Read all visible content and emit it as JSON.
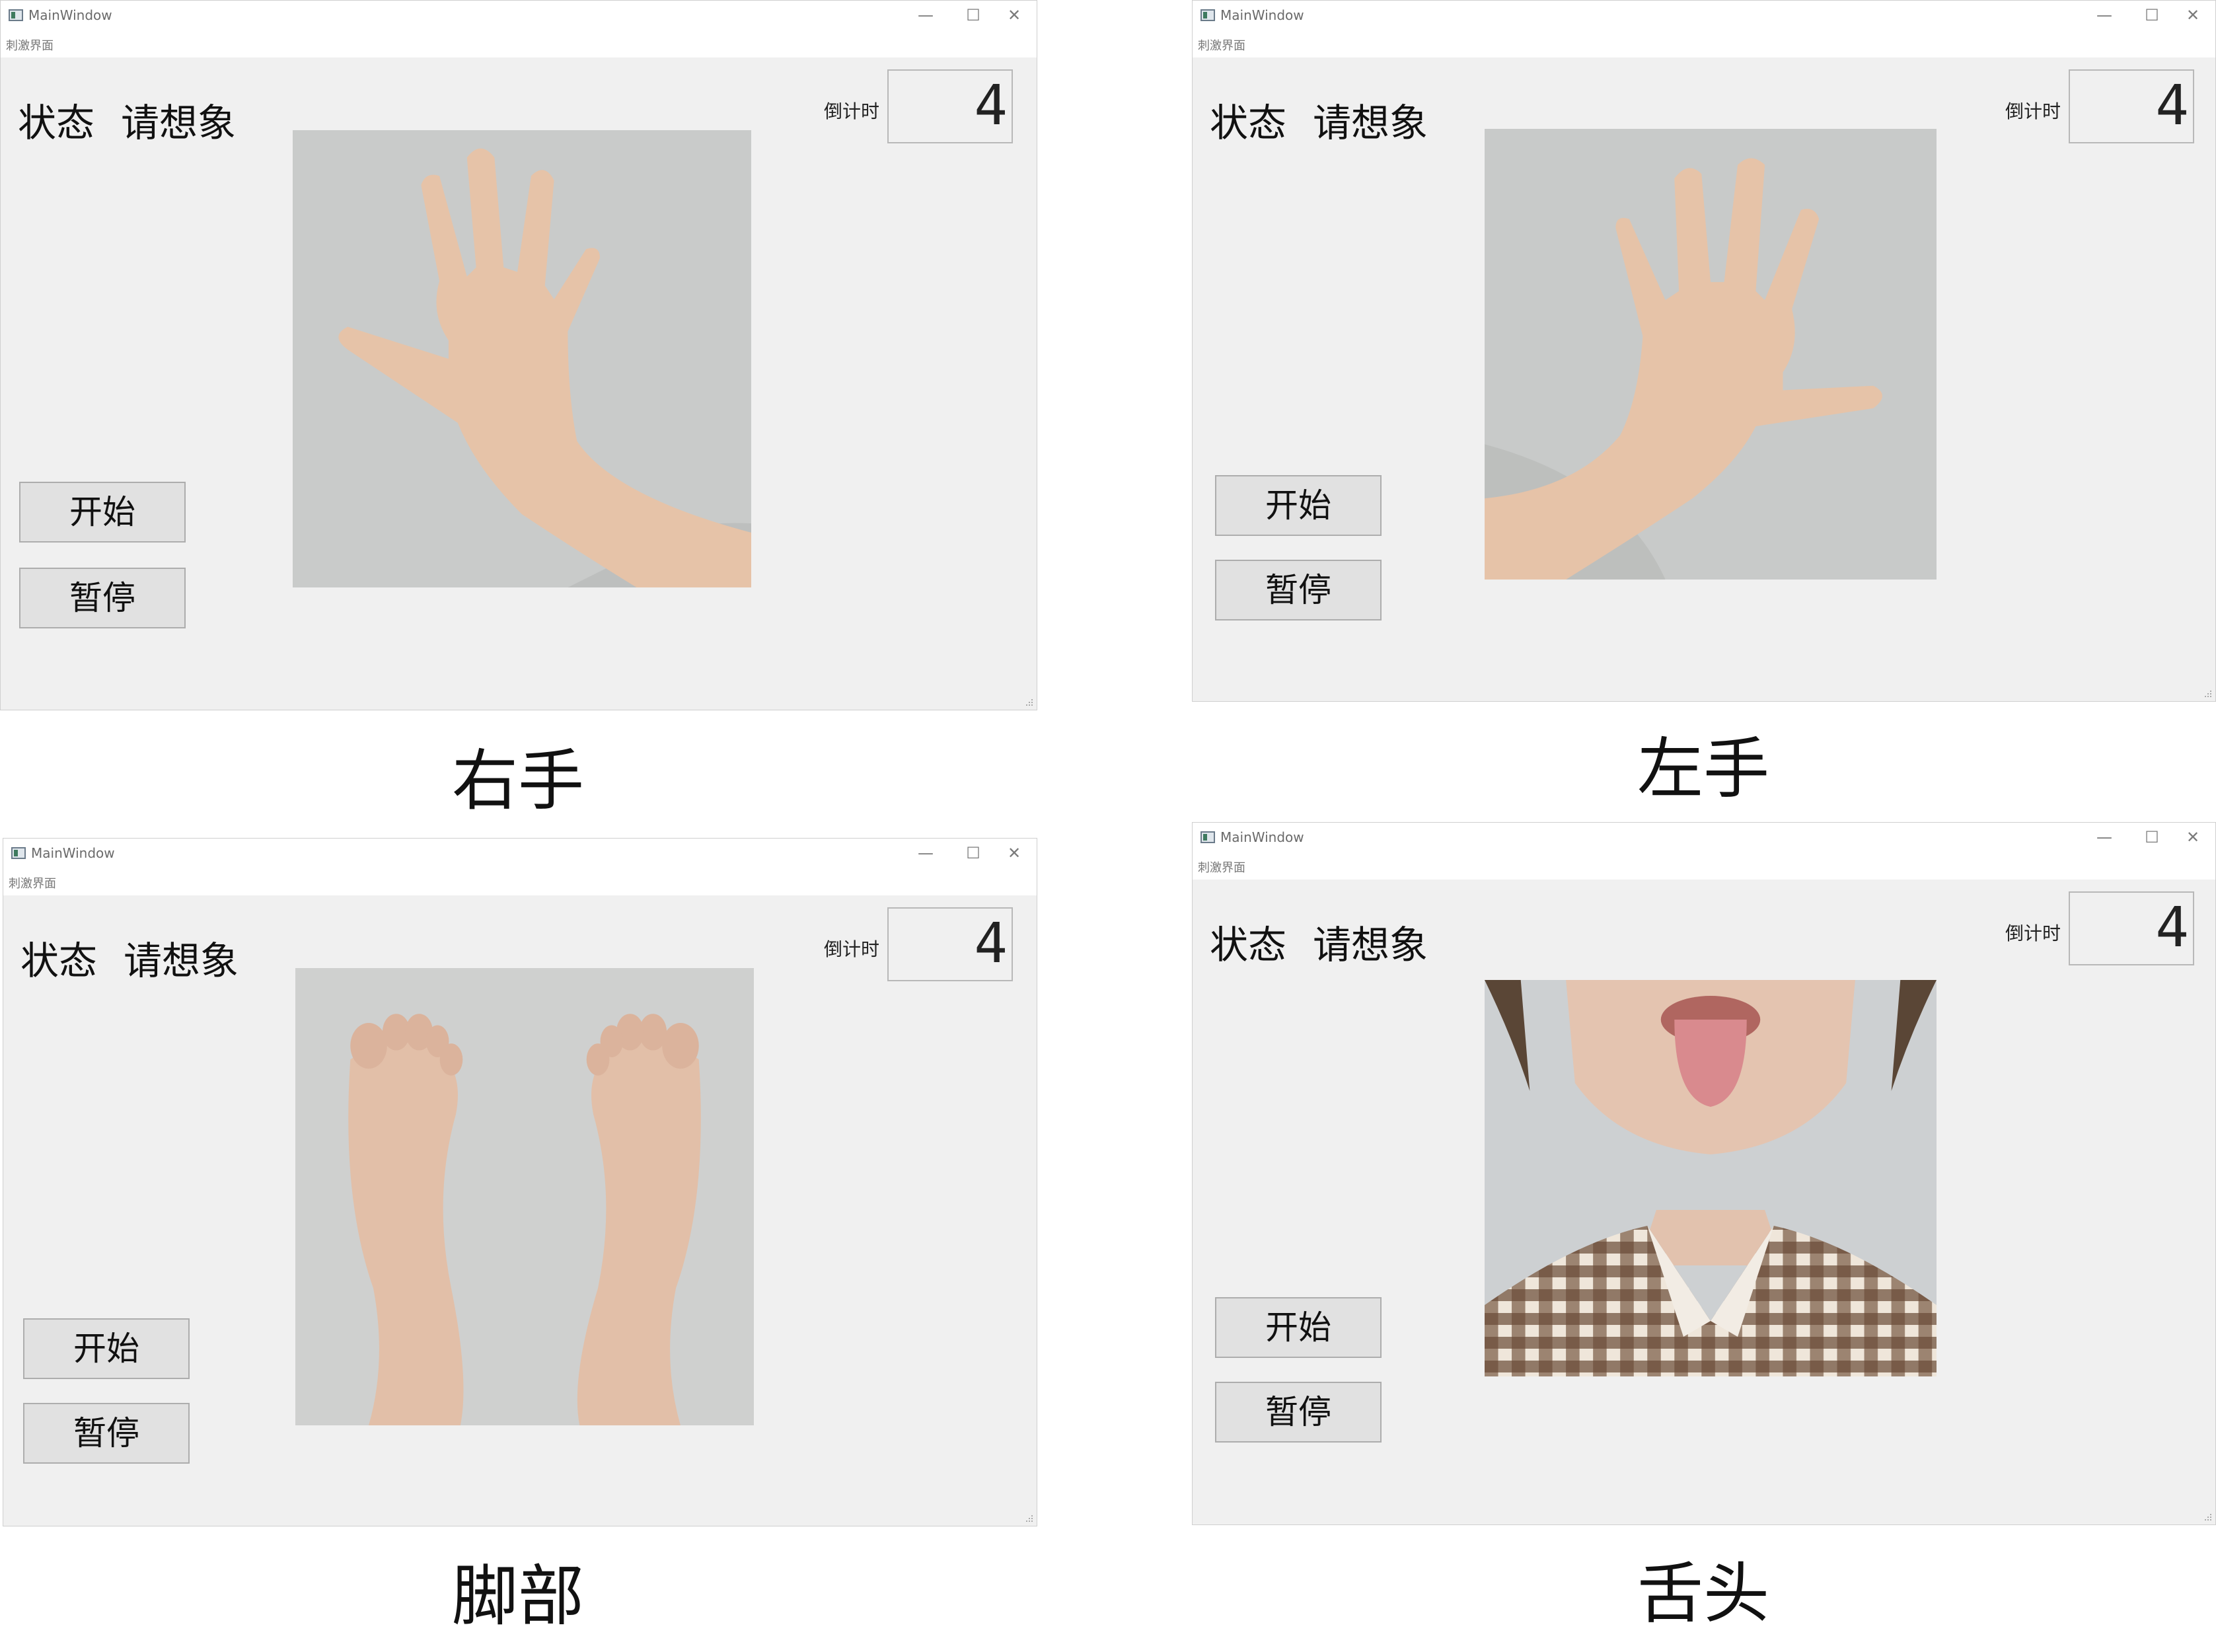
{
  "window": {
    "title": "MainWindow",
    "menu_item": "刺激界面",
    "minimize_symbol": "—",
    "maximize_symbol": "☐",
    "close_symbol": "✕",
    "status_label": "状态",
    "status_value": "请想象",
    "countdown_label": "倒计时",
    "countdown_value": "4",
    "start_button": "开始",
    "pause_button": "暂停"
  },
  "panels": [
    {
      "caption": "右手",
      "image": "right-hand-photo"
    },
    {
      "caption": "左手",
      "image": "left-hand-photo"
    },
    {
      "caption": "脚部",
      "image": "feet-photo"
    },
    {
      "caption": "舌头",
      "image": "tongue-photo"
    }
  ]
}
